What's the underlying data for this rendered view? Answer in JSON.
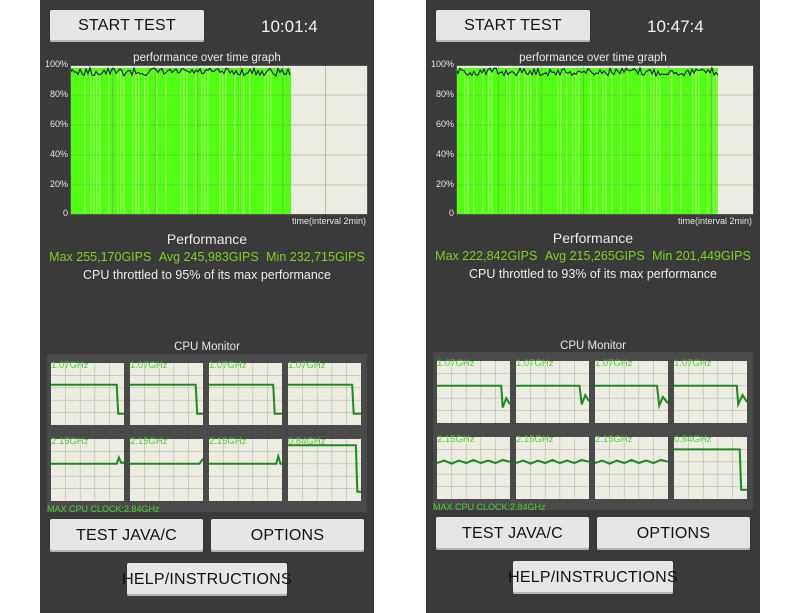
{
  "screens": [
    {
      "start_label": "START TEST",
      "time": "10:01:4",
      "graph_title": "performance over time graph",
      "y_ticks": [
        "100%",
        "80%",
        "60%",
        "40%",
        "20%",
        "0"
      ],
      "x_label": "time(interval 2min)",
      "perf_title": "Performance",
      "max": "Max 255,170GIPS",
      "avg": "Avg 245,983GIPS",
      "min": "Min 232,715GIPS",
      "throttle_text": "CPU throttled to 95% of its max performance",
      "cpu_monitor_title": "CPU Monitor",
      "cores": [
        {
          "label": "1.07GHz",
          "trace": [
            [
              0,
              0.35
            ],
            [
              0.9,
              0.35
            ],
            [
              0.92,
              0.82
            ],
            [
              1,
              0.82
            ]
          ]
        },
        {
          "label": "1.07GHz",
          "trace": [
            [
              0,
              0.35
            ],
            [
              0.9,
              0.35
            ],
            [
              0.92,
              0.82
            ],
            [
              1,
              0.82
            ]
          ]
        },
        {
          "label": "1.07GHz",
          "trace": [
            [
              0,
              0.35
            ],
            [
              0.88,
              0.35
            ],
            [
              0.9,
              0.82
            ],
            [
              1,
              0.82
            ]
          ]
        },
        {
          "label": "1.07GHz",
          "trace": [
            [
              0,
              0.35
            ],
            [
              0.88,
              0.35
            ],
            [
              0.9,
              0.82
            ],
            [
              1,
              0.82
            ]
          ]
        },
        {
          "label": "2.15GHz",
          "trace": [
            [
              0,
              0.4
            ],
            [
              0.9,
              0.4
            ],
            [
              0.93,
              0.3
            ],
            [
              0.96,
              0.38
            ],
            [
              1,
              0.38
            ]
          ]
        },
        {
          "label": "2.15GHz",
          "trace": [
            [
              0,
              0.4
            ],
            [
              0.95,
              0.4
            ],
            [
              1,
              0.32
            ]
          ]
        },
        {
          "label": "2.15GHz",
          "trace": [
            [
              0,
              0.4
            ],
            [
              0.92,
              0.4
            ],
            [
              0.95,
              0.28
            ],
            [
              0.98,
              0.4
            ],
            [
              1,
              0.4
            ]
          ]
        },
        {
          "label": "0.84GHz",
          "trace": [
            [
              0,
              0.1
            ],
            [
              0.93,
              0.1
            ],
            [
              0.95,
              0.85
            ],
            [
              1,
              0.85
            ]
          ]
        }
      ],
      "max_cpu_clock": "MAX CPU CLOCK:2.84GHz",
      "test_label": "TEST JAVA/C",
      "options_label": "OPTIONS",
      "help_label": "HELP/INSTRUCTIONS",
      "progress": 0.74
    },
    {
      "start_label": "START TEST",
      "time": "10:47:4",
      "graph_title": "performance over time graph",
      "y_ticks": [
        "100%",
        "80%",
        "60%",
        "40%",
        "20%",
        "0"
      ],
      "x_label": "time(interval 2min)",
      "perf_title": "Performance",
      "max": "Max 222,842GIPS",
      "avg": "Avg 215,265GIPS",
      "min": "Min 201,449GIPS",
      "throttle_text": "CPU throttled to 93% of its max performance",
      "cpu_monitor_title": "CPU Monitor",
      "cores": [
        {
          "label": "1.07GHz",
          "trace": [
            [
              0,
              0.4
            ],
            [
              0.88,
              0.4
            ],
            [
              0.9,
              0.75
            ],
            [
              0.95,
              0.6
            ],
            [
              1,
              0.7
            ]
          ]
        },
        {
          "label": "1.07GHz",
          "trace": [
            [
              0,
              0.4
            ],
            [
              0.87,
              0.4
            ],
            [
              0.9,
              0.7
            ],
            [
              0.95,
              0.55
            ],
            [
              1,
              0.65
            ]
          ]
        },
        {
          "label": "1.07GHz",
          "trace": [
            [
              0,
              0.4
            ],
            [
              0.85,
              0.4
            ],
            [
              0.88,
              0.72
            ],
            [
              0.93,
              0.58
            ],
            [
              1,
              0.68
            ]
          ]
        },
        {
          "label": "1.07GHz",
          "trace": [
            [
              0,
              0.4
            ],
            [
              0.86,
              0.4
            ],
            [
              0.88,
              0.7
            ],
            [
              0.94,
              0.55
            ],
            [
              1,
              0.66
            ]
          ]
        },
        {
          "label": "2.15GHz",
          "trace": [
            [
              0,
              0.42
            ],
            [
              0.1,
              0.38
            ],
            [
              0.2,
              0.43
            ],
            [
              0.3,
              0.38
            ],
            [
              0.4,
              0.42
            ],
            [
              0.5,
              0.37
            ],
            [
              0.6,
              0.42
            ],
            [
              0.7,
              0.38
            ],
            [
              0.8,
              0.42
            ],
            [
              0.9,
              0.37
            ],
            [
              1,
              0.4
            ]
          ]
        },
        {
          "label": "2.15GHz",
          "trace": [
            [
              0,
              0.42
            ],
            [
              0.1,
              0.38
            ],
            [
              0.2,
              0.43
            ],
            [
              0.3,
              0.38
            ],
            [
              0.4,
              0.42
            ],
            [
              0.5,
              0.37
            ],
            [
              0.6,
              0.42
            ],
            [
              0.7,
              0.38
            ],
            [
              0.8,
              0.42
            ],
            [
              0.9,
              0.37
            ],
            [
              1,
              0.4
            ]
          ]
        },
        {
          "label": "2.15GHz",
          "trace": [
            [
              0,
              0.42
            ],
            [
              0.1,
              0.38
            ],
            [
              0.2,
              0.43
            ],
            [
              0.3,
              0.38
            ],
            [
              0.4,
              0.42
            ],
            [
              0.5,
              0.37
            ],
            [
              0.6,
              0.42
            ],
            [
              0.7,
              0.38
            ],
            [
              0.8,
              0.42
            ],
            [
              0.9,
              0.37
            ],
            [
              1,
              0.4
            ]
          ]
        },
        {
          "label": "0.84GHz",
          "trace": [
            [
              0,
              0.2
            ],
            [
              0.9,
              0.2
            ],
            [
              0.92,
              0.85
            ],
            [
              1,
              0.85
            ]
          ]
        }
      ],
      "max_cpu_clock": "MAX CPU CLOCK:2.84GHz",
      "test_label": "TEST JAVA/C",
      "options_label": "OPTIONS",
      "help_label": "HELP/INSTRUCTIONS",
      "progress": 0.88
    }
  ],
  "colors": {
    "bar_green": "#52ff12",
    "bar_light": "#9bff5e",
    "grid_bg": "#ecece2",
    "trace": "#1e8a1e",
    "line_dark": "#1a1a40",
    "core_label": "#4fd137"
  }
}
